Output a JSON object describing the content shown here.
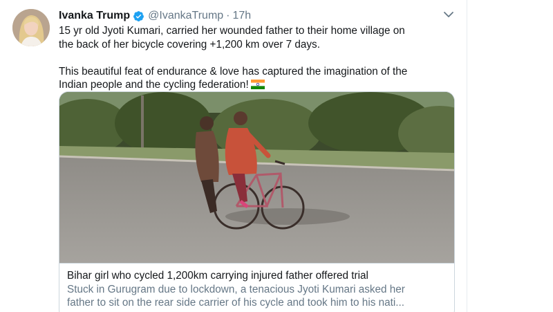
{
  "tweet": {
    "author_name": "Ivanka Trump",
    "handle": "@IvankaTrump",
    "separator": "·",
    "time": "17h",
    "text_lines": [
      "15 yr old Jyoti Kumari, carried her wounded father to their home village on",
      "the back of her bicycle covering +1,200 km over 7 days.",
      "This beautiful feat of endurance & love has captured the imagination of the",
      "Indian people and the cycling federation!"
    ],
    "icons": {
      "verified": "verified-badge-icon",
      "menu": "chevron-down-icon",
      "flag": "india-flag-emoji"
    }
  },
  "card": {
    "title": "Bihar girl who cycled 1,200km carrying injured father offered trial",
    "description_lines": [
      "Stuck in Gurugram due to lockdown, a tenacious Jyoti Kumari asked her",
      "father to sit on the rear side carrier of his cycle and took him to his nati..."
    ]
  },
  "colors": {
    "text": "#14171a",
    "secondary": "#657786",
    "verified": "#1da1f2",
    "border": "#ccd6dd"
  }
}
